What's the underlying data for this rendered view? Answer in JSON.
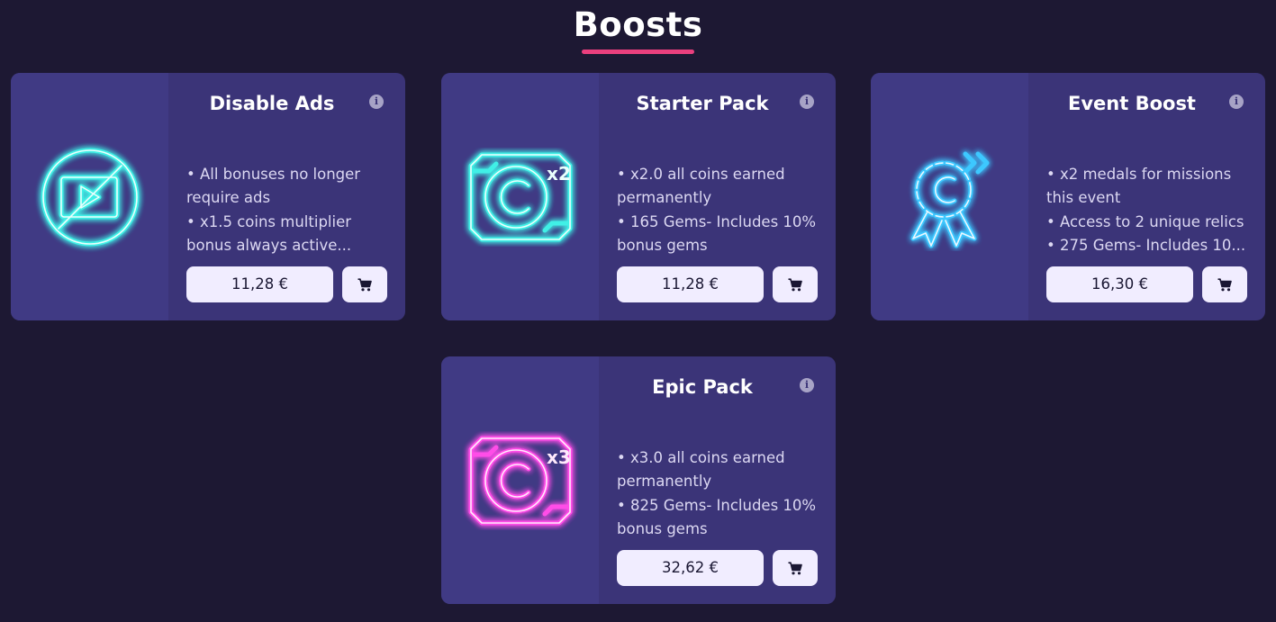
{
  "page": {
    "title": "Boosts"
  },
  "colors": {
    "background": "#1d1833",
    "card": "#3b3478",
    "accent": "#ea3f7e",
    "teal_glow": "#3ff0e6",
    "blue_glow": "#3ec8ff",
    "pink_glow": "#ff4de8"
  },
  "cards": [
    {
      "title": "Disable Ads",
      "icon": "no-ads-icon",
      "lines": [
        "• All bonuses no longer",
        "require ads",
        "• x1.5 coins multiplier",
        "bonus always active..."
      ],
      "price": "11,28 €"
    },
    {
      "title": "Starter Pack",
      "icon": "coin-x2-icon",
      "badge": "x2",
      "lines": [
        "• x2.0 all coins earned",
        "permanently",
        "• 165 Gems- Includes 10%",
        "bonus gems"
      ],
      "price": "11,28 €"
    },
    {
      "title": "Event Boost",
      "icon": "medal-boost-icon",
      "lines": [
        "• x2 medals for missions",
        "this event",
        "• Access to 2 unique relics",
        "• 275 Gems- Includes 10..."
      ],
      "price": "16,30 €"
    },
    {
      "title": "Epic Pack",
      "icon": "coin-x3-icon",
      "badge": "x3",
      "lines": [
        "• x3.0 all coins earned",
        "permanently",
        "• 825 Gems- Includes 10%",
        "bonus gems"
      ],
      "price": "32,62 €"
    }
  ]
}
